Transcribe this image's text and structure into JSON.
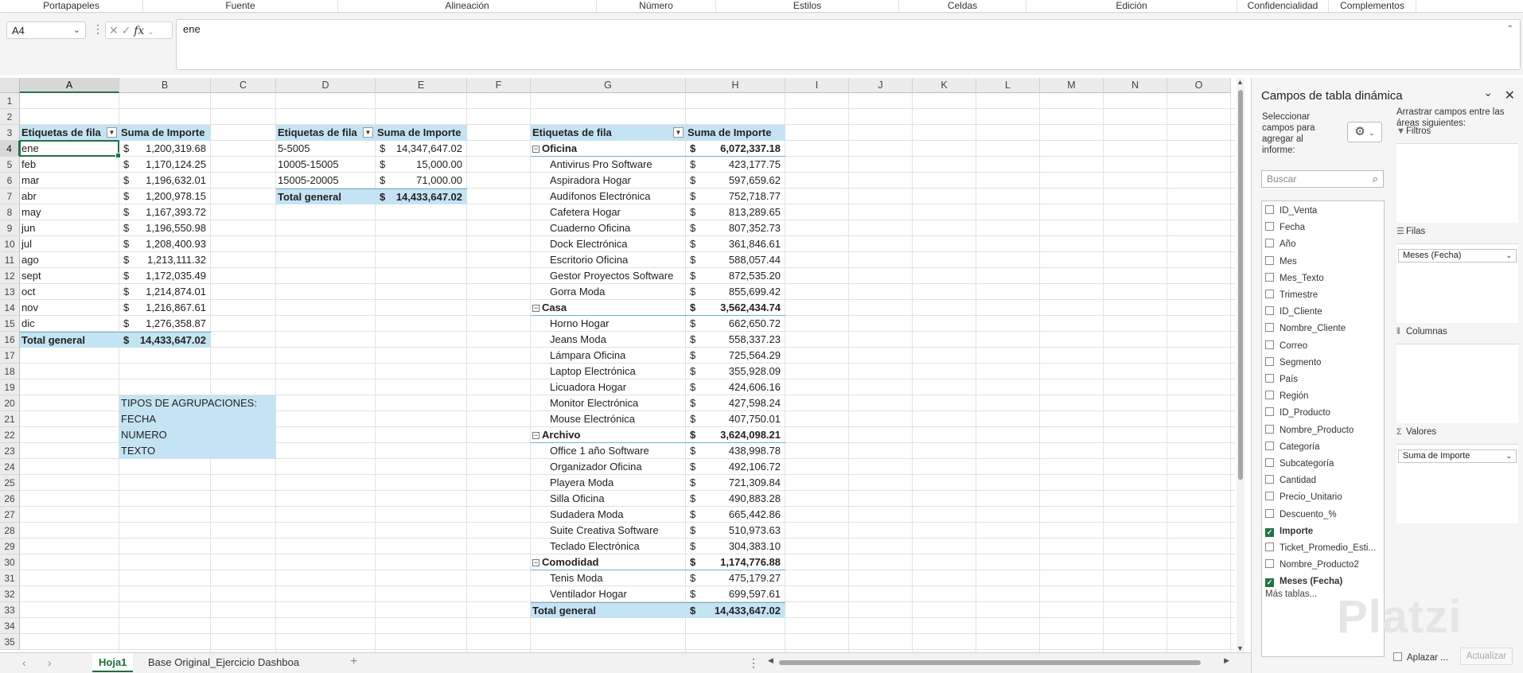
{
  "ribbon": {
    "groups": [
      "Portapapeles",
      "Fuente",
      "Alineación",
      "Número",
      "Estilos",
      "Celdas",
      "Edición",
      "Confidencialidad",
      "Complementos"
    ]
  },
  "formula_bar": {
    "name_box": "A4",
    "fx_symbol": "fx",
    "content": "ene"
  },
  "grid": {
    "columns": [
      "A",
      "B",
      "C",
      "D",
      "E",
      "F",
      "G",
      "H",
      "I",
      "J",
      "K",
      "L",
      "M",
      "N",
      "O"
    ],
    "selected_column": "A",
    "selected_row": "4",
    "rows": [
      "1",
      "2",
      "3",
      "4",
      "5",
      "6",
      "7",
      "8",
      "9",
      "10",
      "11",
      "12",
      "13",
      "14",
      "15",
      "16",
      "17",
      "18",
      "19",
      "20",
      "21",
      "22",
      "23",
      "24",
      "25",
      "26",
      "27",
      "28",
      "29",
      "30",
      "31",
      "32",
      "33",
      "34",
      "35"
    ]
  },
  "pivot_months": {
    "header_label": "Etiquetas de fila",
    "header_value": "Suma de Importe",
    "rows": [
      {
        "label": "ene",
        "cur": "$",
        "value": "1,200,319.68"
      },
      {
        "label": "feb",
        "cur": "$",
        "value": "1,170,124.25"
      },
      {
        "label": "mar",
        "cur": "$",
        "value": "1,196,632.01"
      },
      {
        "label": "abr",
        "cur": "$",
        "value": "1,200,978.15"
      },
      {
        "label": "may",
        "cur": "$",
        "value": "1,167,393.72"
      },
      {
        "label": "jun",
        "cur": "$",
        "value": "1,196,550.98"
      },
      {
        "label": "jul",
        "cur": "$",
        "value": "1,208,400.93"
      },
      {
        "label": "ago",
        "cur": "$",
        "value": "1,213,111.32"
      },
      {
        "label": "sept",
        "cur": "$",
        "value": "1,172,035.49"
      },
      {
        "label": "oct",
        "cur": "$",
        "value": "1,214,874.01"
      },
      {
        "label": "nov",
        "cur": "$",
        "value": "1,216,867.61"
      },
      {
        "label": "dic",
        "cur": "$",
        "value": "1,276,358.87"
      }
    ],
    "total_label": "Total general",
    "total_cur": "$",
    "total_value": "14,433,647.02"
  },
  "groupings_note": [
    "TIPOS DE AGRUPACIONES:",
    "FECHA",
    "NUMERO",
    "TEXTO"
  ],
  "pivot_ranges": {
    "header_label": "Etiquetas de fila",
    "header_value": "Suma de Importe",
    "rows": [
      {
        "label": "5-5005",
        "cur": "$",
        "value": "14,347,647.02"
      },
      {
        "label": "10005-15005",
        "cur": "$",
        "value": "15,000.00"
      },
      {
        "label": "15005-20005",
        "cur": "$",
        "value": "71,000.00"
      }
    ],
    "total_label": "Total general",
    "total_cur": "$",
    "total_value": "14,433,647.02"
  },
  "pivot_products": {
    "header_label": "Etiquetas de fila",
    "header_value": "Suma de Importe",
    "rows": [
      {
        "label": "Oficina",
        "cur": "$",
        "value": "6,072,337.18",
        "group": true
      },
      {
        "label": "Antivirus Pro Software",
        "cur": "$",
        "value": "423,177.75"
      },
      {
        "label": "Aspiradora Hogar",
        "cur": "$",
        "value": "597,659.62"
      },
      {
        "label": "Audífonos Electrónica",
        "cur": "$",
        "value": "752,718.77"
      },
      {
        "label": "Cafetera Hogar",
        "cur": "$",
        "value": "813,289.65"
      },
      {
        "label": "Cuaderno Oficina",
        "cur": "$",
        "value": "807,352.73"
      },
      {
        "label": "Dock Electrónica",
        "cur": "$",
        "value": "361,846.61"
      },
      {
        "label": "Escritorio Oficina",
        "cur": "$",
        "value": "588,057.44"
      },
      {
        "label": "Gestor Proyectos Software",
        "cur": "$",
        "value": "872,535.20"
      },
      {
        "label": "Gorra Moda",
        "cur": "$",
        "value": "855,699.42"
      },
      {
        "label": "Casa",
        "cur": "$",
        "value": "3,562,434.74",
        "group": true
      },
      {
        "label": "Horno Hogar",
        "cur": "$",
        "value": "662,650.72"
      },
      {
        "label": "Jeans Moda",
        "cur": "$",
        "value": "558,337.23"
      },
      {
        "label": "Lámpara Oficina",
        "cur": "$",
        "value": "725,564.29"
      },
      {
        "label": "Laptop Electrónica",
        "cur": "$",
        "value": "355,928.09"
      },
      {
        "label": "Licuadora Hogar",
        "cur": "$",
        "value": "424,606.16"
      },
      {
        "label": "Monitor Electrónica",
        "cur": "$",
        "value": "427,598.24"
      },
      {
        "label": "Mouse Electrónica",
        "cur": "$",
        "value": "407,750.01"
      },
      {
        "label": "Archivo",
        "cur": "$",
        "value": "3,624,098.21",
        "group": true
      },
      {
        "label": "Office 1 año Software",
        "cur": "$",
        "value": "438,998.78"
      },
      {
        "label": "Organizador Oficina",
        "cur": "$",
        "value": "492,106.72"
      },
      {
        "label": "Playera Moda",
        "cur": "$",
        "value": "721,309.84"
      },
      {
        "label": "Silla Oficina",
        "cur": "$",
        "value": "490,883.28"
      },
      {
        "label": "Sudadera Moda",
        "cur": "$",
        "value": "665,442.86"
      },
      {
        "label": "Suite Creativa Software",
        "cur": "$",
        "value": "510,973.63"
      },
      {
        "label": "Teclado Electrónica",
        "cur": "$",
        "value": "304,383.10"
      },
      {
        "label": "Comodidad",
        "cur": "$",
        "value": "1,174,776.88",
        "group": true
      },
      {
        "label": "Tenis Moda",
        "cur": "$",
        "value": "475,179.27"
      },
      {
        "label": "Ventilador Hogar",
        "cur": "$",
        "value": "699,597.61"
      }
    ],
    "total_label": "Total general",
    "total_cur": "$",
    "total_value": "14,433,647.02"
  },
  "sheet_tabs": {
    "tabs": [
      "Hoja1",
      "Base Original_Ejercicio Dashboa"
    ],
    "active": "Hoja1",
    "add": "+",
    "nav_prev": "‹",
    "nav_next": "›",
    "menu": "⋮"
  },
  "pivot_panel": {
    "title": "Campos de tabla dinámica",
    "select_text": "Seleccionar campos para agregar al informe:",
    "drag_text": "Arrastrar campos entre las áreas siguientes:",
    "search_placeholder": "Buscar",
    "fields": [
      {
        "name": "ID_Venta",
        "checked": false
      },
      {
        "name": "Fecha",
        "checked": false
      },
      {
        "name": "Año",
        "checked": false
      },
      {
        "name": "Mes",
        "checked": false
      },
      {
        "name": "Mes_Texto",
        "checked": false
      },
      {
        "name": "Trimestre",
        "checked": false
      },
      {
        "name": "ID_Cliente",
        "checked": false
      },
      {
        "name": "Nombre_Cliente",
        "checked": false
      },
      {
        "name": "Correo",
        "checked": false
      },
      {
        "name": "Segmento",
        "checked": false
      },
      {
        "name": "País",
        "checked": false
      },
      {
        "name": "Región",
        "checked": false
      },
      {
        "name": "ID_Producto",
        "checked": false
      },
      {
        "name": "Nombre_Producto",
        "checked": false
      },
      {
        "name": "Categoría",
        "checked": false
      },
      {
        "name": "Subcategoría",
        "checked": false
      },
      {
        "name": "Cantidad",
        "checked": false
      },
      {
        "name": "Precio_Unitario",
        "checked": false
      },
      {
        "name": "Descuento_%",
        "checked": false
      },
      {
        "name": "Importe",
        "checked": true
      },
      {
        "name": "Ticket_Promedio_Esti...",
        "checked": false
      },
      {
        "name": "Nombre_Producto2",
        "checked": false
      },
      {
        "name": "Meses (Fecha)",
        "checked": true
      }
    ],
    "more_tables": "Más tablas...",
    "areas": {
      "filters": {
        "label": "Filtros",
        "items": []
      },
      "rows": {
        "label": "Filas",
        "items": [
          "Meses (Fecha)"
        ]
      },
      "columns": {
        "label": "Columnas",
        "items": []
      },
      "values": {
        "label": "Valores",
        "items": [
          "Suma de Importe"
        ]
      }
    },
    "defer_label": "Aplazar ...",
    "update_label": "Actualizar"
  },
  "watermark": "Platzi"
}
